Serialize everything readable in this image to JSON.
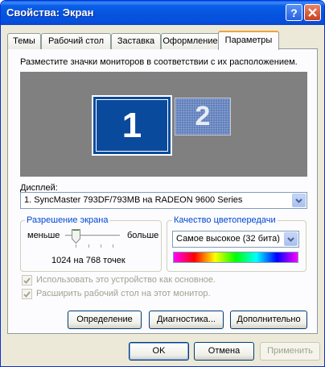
{
  "window": {
    "title": "Свойства: Экран"
  },
  "tabs": [
    {
      "label": "Темы"
    },
    {
      "label": "Рабочий стол"
    },
    {
      "label": "Заставка"
    },
    {
      "label": "Оформление"
    },
    {
      "label": "Параметры",
      "active": true
    }
  ],
  "settings": {
    "instruction": "Разместите значки мониторов в соответствии с их расположением.",
    "monitors": [
      "1",
      "2"
    ],
    "display_label": "Дисплей:",
    "display_value": "1. SyncMaster 793DF/793MB на RADEON 9600 Series",
    "resolution": {
      "title": "Разрешение экрана",
      "less": "меньше",
      "more": "больше",
      "value": "1024 на 768 точек"
    },
    "color_quality": {
      "title": "Качество цветопередачи",
      "value": "Самое высокое (32 бита)"
    },
    "checkbox_primary": "Использовать это устройство как основное.",
    "checkbox_extend": "Расширить рабочий стол на этот монитор.",
    "buttons": {
      "identify": "Определение",
      "troubleshoot": "Диагностика...",
      "advanced": "Дополнительно"
    }
  },
  "footer": {
    "ok": "OK",
    "cancel": "Отмена",
    "apply": "Применить"
  },
  "colors": {
    "titlebar": "#0a5ee8",
    "group_title": "#0046d5",
    "monitor_selected": "#0a4a9c",
    "monitor_background": "#808080"
  }
}
